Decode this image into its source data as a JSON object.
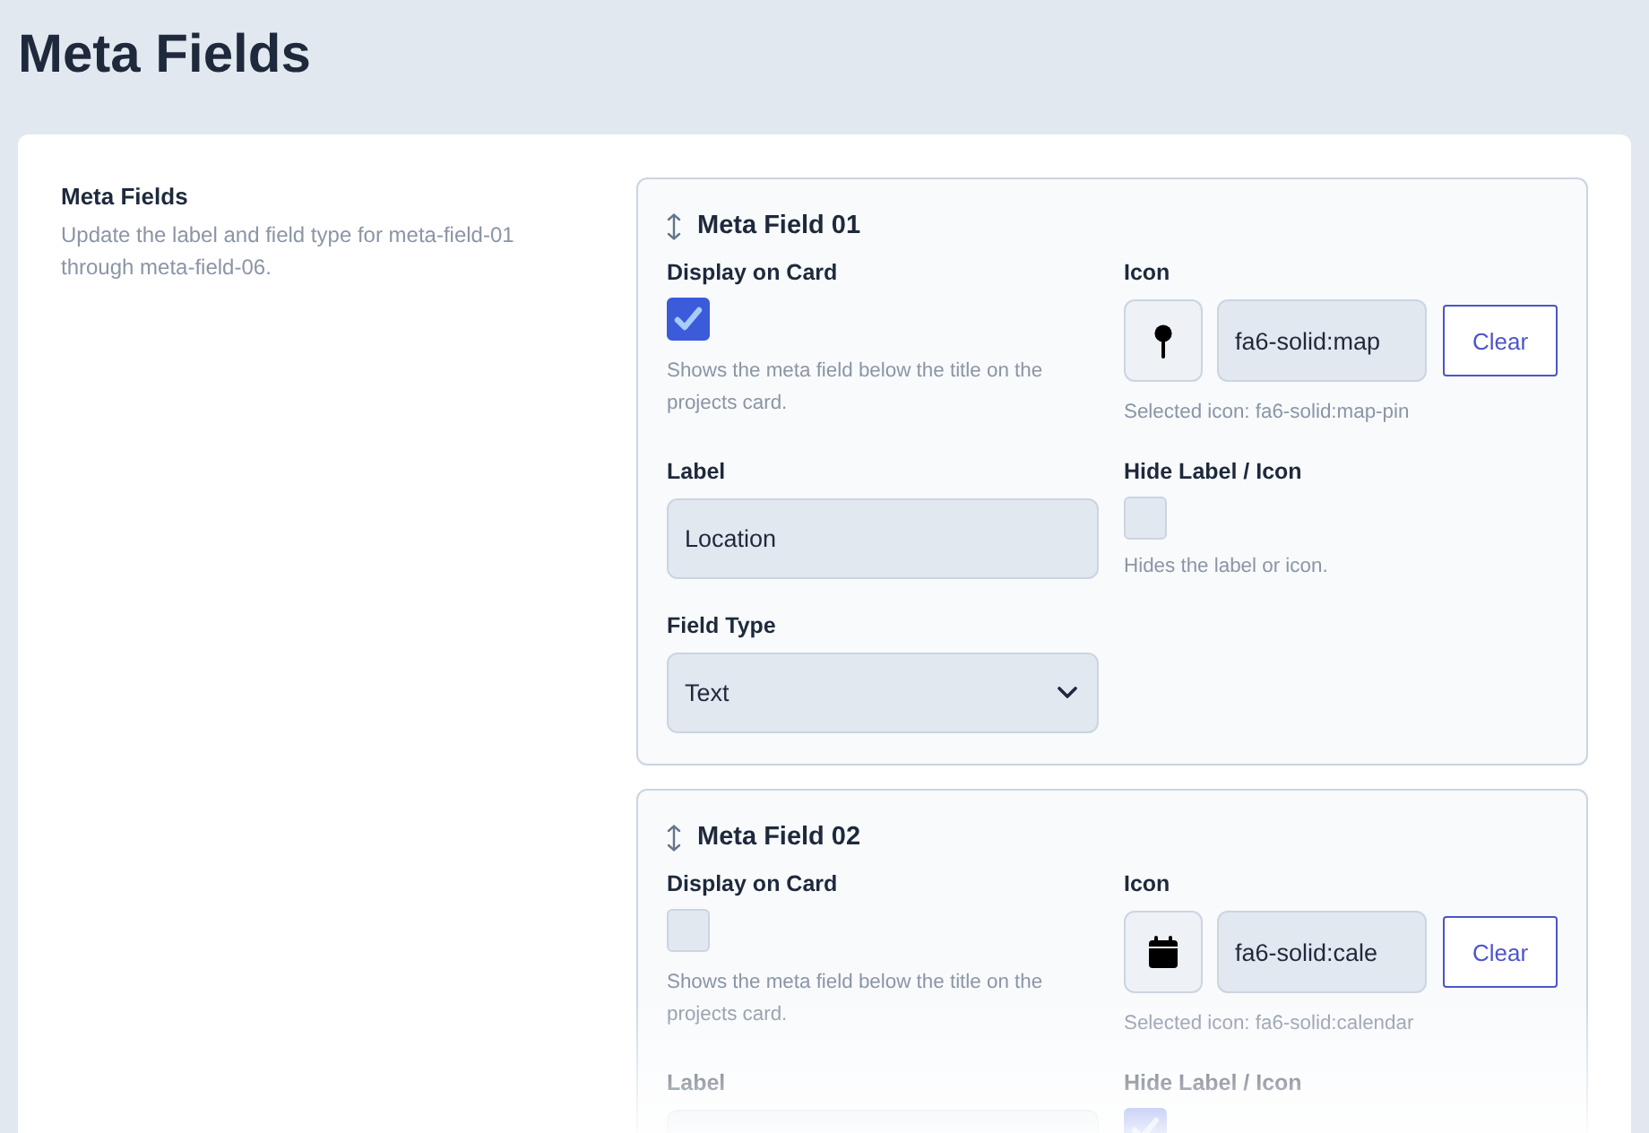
{
  "page": {
    "title": "Meta Fields"
  },
  "section": {
    "title": "Meta Fields",
    "description": "Update the label and field type for meta-field-01 through meta-field-06."
  },
  "meta_fields": [
    {
      "title": "Meta Field 01",
      "display_on_card": {
        "label": "Display on Card",
        "checked": true,
        "help": "Shows the meta field below the title on the projects card."
      },
      "icon": {
        "label": "Icon",
        "kind": "pin",
        "value": "fa6-solid:map",
        "button": "Clear",
        "selected_text": "Selected icon: fa6-solid:map-pin"
      },
      "label_field": {
        "label": "Label",
        "value": "Location"
      },
      "hide_label": {
        "label": "Hide Label / Icon",
        "checked": false,
        "help": "Hides the label or icon."
      },
      "field_type": {
        "label": "Field Type",
        "value": "Text"
      }
    },
    {
      "title": "Meta Field 02",
      "display_on_card": {
        "label": "Display on Card",
        "checked": false,
        "help": "Shows the meta field below the title on the projects card."
      },
      "icon": {
        "label": "Icon",
        "kind": "calendar",
        "value": "fa6-solid:cale",
        "button": "Clear",
        "selected_text": "Selected icon: fa6-solid:calendar"
      },
      "label_field": {
        "label": "Label"
      },
      "hide_label": {
        "label": "Hide Label / Icon",
        "checked": true
      }
    }
  ]
}
